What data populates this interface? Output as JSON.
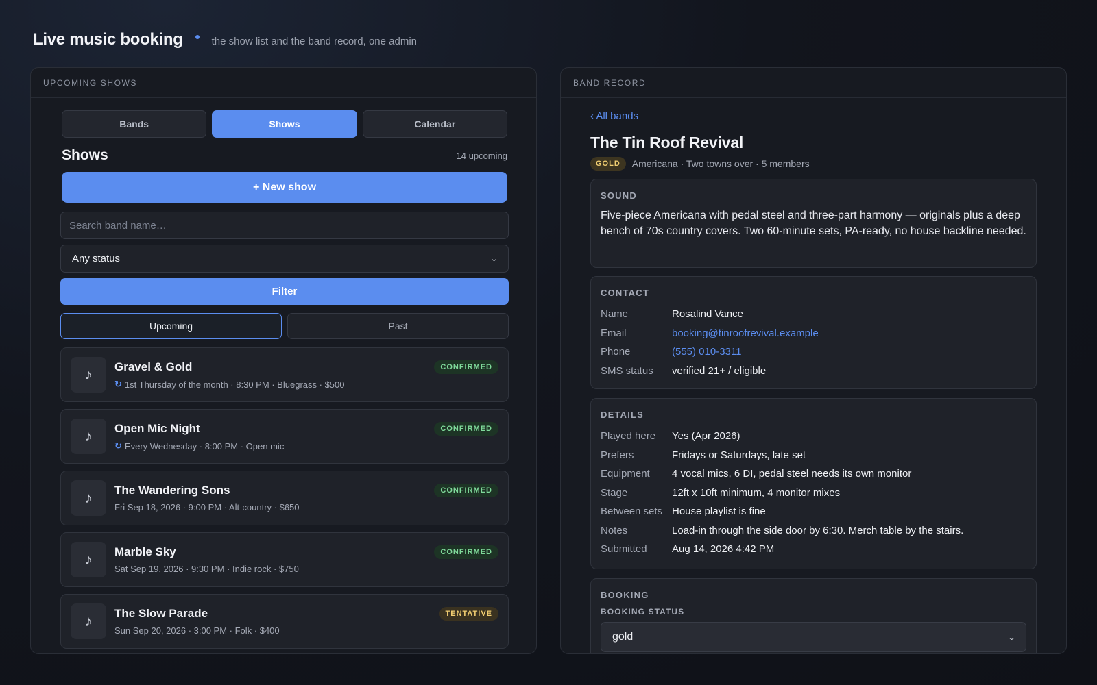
{
  "header": {
    "title": "Live music booking",
    "subtitle": "the show list and the band record, one admin"
  },
  "left_panel": {
    "heading": "UPCOMING SHOWS",
    "tabs": [
      {
        "label": "Bands",
        "active": false
      },
      {
        "label": "Shows",
        "active": true
      },
      {
        "label": "Calendar",
        "active": false
      }
    ],
    "shows_title": "Shows",
    "shows_count": "14 upcoming",
    "new_show_label": "+ New show",
    "search_placeholder": "Search band name…",
    "status_filter_value": "Any status",
    "filter_label": "Filter",
    "time_toggle": [
      {
        "label": "Upcoming",
        "active": true
      },
      {
        "label": "Past",
        "active": false
      }
    ],
    "shows": [
      {
        "name": "Gravel & Gold",
        "meta": "1st Thursday of the month · 8:30 PM · Bluegrass · $500",
        "recurring": true,
        "status": "CONFIRMED"
      },
      {
        "name": "Open Mic Night",
        "meta": "Every Wednesday · 8:00 PM · Open mic",
        "recurring": true,
        "status": "CONFIRMED"
      },
      {
        "name": "The Wandering Sons",
        "meta": "Fri Sep 18, 2026 · 9:00 PM · Alt-country · $650",
        "recurring": false,
        "status": "CONFIRMED"
      },
      {
        "name": "Marble Sky",
        "meta": "Sat Sep 19, 2026 · 9:30 PM · Indie rock · $750",
        "recurring": false,
        "status": "CONFIRMED"
      },
      {
        "name": "The Slow Parade",
        "meta": "Sun Sep 20, 2026 · 3:00 PM · Folk · $400",
        "recurring": false,
        "status": "TENTATIVE"
      }
    ]
  },
  "right_panel": {
    "heading": "BAND RECORD",
    "back_label": "‹ All bands",
    "band_name": "The Tin Roof Revival",
    "tier": "GOLD",
    "band_meta": "Americana · Two towns over · 5 members",
    "sound": {
      "title": "SOUND",
      "text": "Five-piece Americana with pedal steel and three-part harmony — originals plus a deep bench of 70s country covers. Two 60-minute sets, PA-ready, no house backline needed."
    },
    "contact": {
      "title": "CONTACT",
      "rows": [
        {
          "k": "Name",
          "v": "Rosalind Vance"
        },
        {
          "k": "Email",
          "v": "booking@tinroofrevival.example"
        },
        {
          "k": "Phone",
          "v": "(555) 010-3311"
        },
        {
          "k": "SMS status",
          "v": "verified 21+ / eligible"
        }
      ]
    },
    "details": {
      "title": "DETAILS",
      "rows": [
        {
          "k": "Played here",
          "v": "Yes (Apr 2026)"
        },
        {
          "k": "Prefers",
          "v": "Fridays or Saturdays, late set"
        },
        {
          "k": "Equipment",
          "v": "4 vocal mics, 6 DI, pedal steel needs its own monitor"
        },
        {
          "k": "Stage",
          "v": "12ft x 10ft minimum, 4 monitor mixes"
        },
        {
          "k": "Between sets",
          "v": "House playlist is fine"
        },
        {
          "k": "Notes",
          "v": "Load-in through the side door by 6:30. Merch table by the stairs."
        },
        {
          "k": "Submitted",
          "v": "Aug 14, 2026 4:42 PM"
        }
      ]
    },
    "booking": {
      "title": "BOOKING",
      "status_label": "BOOKING STATUS",
      "status_value": "gold"
    }
  },
  "colors": {
    "accent": "#5b8def",
    "confirmed": "#7fd99a",
    "tentative": "#f3cf72"
  }
}
